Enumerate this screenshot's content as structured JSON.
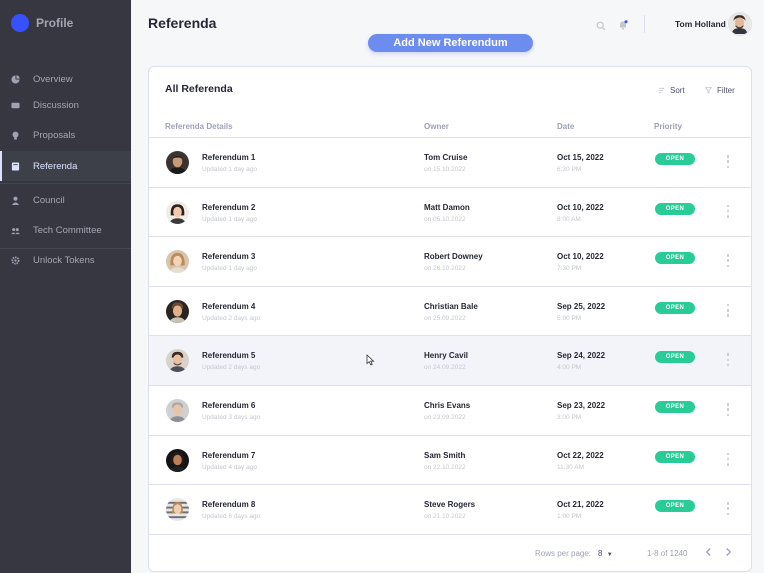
{
  "brand": {
    "name": "Profile",
    "accent": "#3751ff"
  },
  "sidebar": {
    "items": [
      {
        "label": "Overview",
        "icon": "pie-chart-icon"
      },
      {
        "label": "Discussion",
        "icon": "ticket-icon"
      },
      {
        "label": "Proposals",
        "icon": "lightbulb-icon"
      },
      {
        "label": "Referenda",
        "icon": "book-icon",
        "active": true
      },
      {
        "label": "Council",
        "icon": "person-icon"
      },
      {
        "label": "Tech Committee",
        "icon": "group-icon"
      },
      {
        "label": "Unlock Tokens",
        "icon": "gear-icon"
      }
    ]
  },
  "header": {
    "title": "Referenda",
    "add_button_label": "Add New Referendum",
    "user_name": "Tom Holland",
    "icons": [
      "search-icon",
      "bell-icon"
    ]
  },
  "table": {
    "title": "All Referenda",
    "sort_label": "Sort",
    "filter_label": "Filter",
    "columns": [
      "Referenda Details",
      "Owner",
      "Date",
      "Priority"
    ],
    "rows": [
      {
        "name": "Referendum 1",
        "updated": "Updated 1 day ago",
        "owner": "Tom Cruise",
        "owner_date": "on 15.10.2022",
        "date": "Oct 15, 2022",
        "time": "6:30 PM",
        "status": "OPEN"
      },
      {
        "name": "Referendum 2",
        "updated": "Updated 1 day ago",
        "owner": "Matt Damon",
        "owner_date": "on 05.10.2022",
        "date": "Oct 10, 2022",
        "time": "8:00 AM",
        "status": "OPEN"
      },
      {
        "name": "Referendum 3",
        "updated": "Updated 1 day ago",
        "owner": "Robert Downey",
        "owner_date": "on 26.10.2022",
        "date": "Oct 10, 2022",
        "time": "7:30 PM",
        "status": "OPEN"
      },
      {
        "name": "Referendum 4",
        "updated": "Updated 2 days ago",
        "owner": "Christian Bale",
        "owner_date": "on 25.09.2022",
        "date": "Sep 25, 2022",
        "time": "5:00 PM",
        "status": "OPEN"
      },
      {
        "name": "Referendum 5",
        "updated": "Updated 2 days ago",
        "owner": "Henry Cavil",
        "owner_date": "on 24.09.2022",
        "date": "Sep 24, 2022",
        "time": "4:00 PM",
        "status": "OPEN"
      },
      {
        "name": "Referendum 6",
        "updated": "Updated 3 days ago",
        "owner": "Chris Evans",
        "owner_date": "on 23.09.2022",
        "date": "Sep 23, 2022",
        "time": "3:00 PM",
        "status": "OPEN"
      },
      {
        "name": "Referendum 7",
        "updated": "Updated 4 day ago",
        "owner": "Sam Smith",
        "owner_date": "on 22.10.2022",
        "date": "Oct 22, 2022",
        "time": "11:30 AM",
        "status": "OPEN"
      },
      {
        "name": "Referendum 8",
        "updated": "Updated 6 days ago",
        "owner": "Steve Rogers",
        "owner_date": "on 21.10.2022",
        "date": "Oct 21, 2022",
        "time": "1:00 PM",
        "status": "OPEN"
      }
    ],
    "footer": {
      "rows_per_page_label": "Rows per page:",
      "rows_per_page_value": "8",
      "range_label": "1-8 of 1240"
    }
  },
  "colors": {
    "sidebar_bg": "#363740",
    "status_open": "#29cc97",
    "button_bg": "#6c8cf0"
  }
}
